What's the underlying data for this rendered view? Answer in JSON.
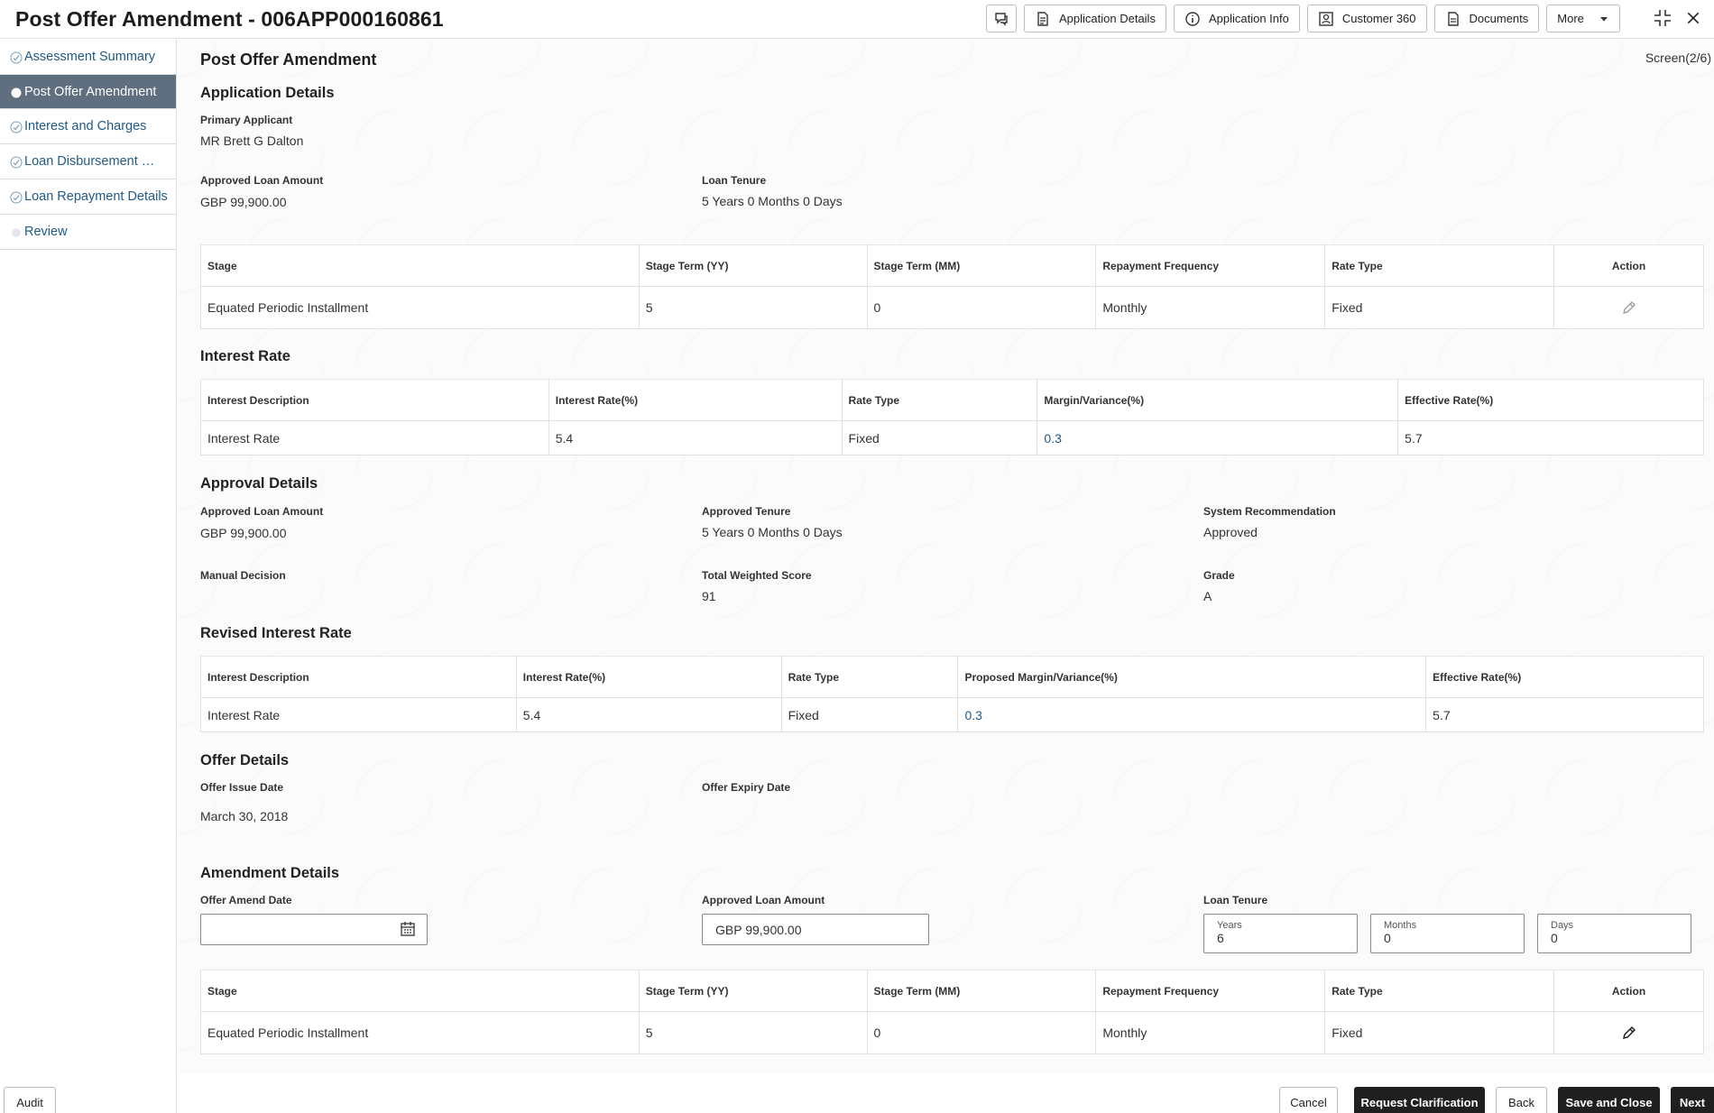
{
  "header": {
    "title": "Post Offer Amendment - 006APP000160861",
    "buttons": {
      "application_details": "Application Details",
      "application_info": "Application Info",
      "customer_360": "Customer 360",
      "documents": "Documents",
      "more": "More"
    }
  },
  "sidebar": {
    "items": [
      {
        "label": "Assessment Summary"
      },
      {
        "label": "Post Offer Amendment"
      },
      {
        "label": "Interest and Charges"
      },
      {
        "label": "Loan Disbursement Det..."
      },
      {
        "label": "Loan Repayment Details"
      },
      {
        "label": "Review"
      }
    ]
  },
  "main": {
    "title": "Post Offer Amendment",
    "screen": "Screen(2/6)",
    "application_details": {
      "heading": "Application Details",
      "primary_applicant_label": "Primary Applicant",
      "primary_applicant": "MR Brett G Dalton",
      "approved_amount_label": "Approved Loan Amount",
      "approved_amount": "GBP 99,900.00",
      "loan_tenure_label": "Loan Tenure",
      "loan_tenure": "5 Years 0 Months 0 Days",
      "stage_table": {
        "headers": [
          "Stage",
          "Stage Term (YY)",
          "Stage Term (MM)",
          "Repayment Frequency",
          "Rate Type",
          "Action"
        ],
        "row": [
          "Equated Periodic Installment",
          "5",
          "0",
          "Monthly",
          "Fixed"
        ]
      }
    },
    "interest_rate": {
      "heading": "Interest Rate",
      "headers": [
        "Interest Description",
        "Interest Rate(%)",
        "Rate Type",
        "Margin/Variance(%)",
        "Effective Rate(%)"
      ],
      "row": [
        "Interest Rate",
        "5.4",
        "Fixed",
        "0.3",
        "5.7"
      ]
    },
    "approval_details": {
      "heading": "Approval Details",
      "approved_amount_label": "Approved Loan Amount",
      "approved_amount": "GBP 99,900.00",
      "approved_tenure_label": "Approved Tenure",
      "approved_tenure": "5 Years 0 Months 0 Days",
      "system_rec_label": "System Recommendation",
      "system_rec": "Approved",
      "manual_decision_label": "Manual Decision",
      "total_score_label": "Total Weighted Score",
      "total_score": "91",
      "grade_label": "Grade",
      "grade": "A"
    },
    "revised_interest_rate": {
      "heading": "Revised Interest Rate",
      "headers": [
        "Interest Description",
        "Interest Rate(%)",
        "Rate Type",
        "Proposed Margin/Variance(%)",
        "Effective Rate(%)"
      ],
      "row": [
        "Interest Rate",
        "5.4",
        "Fixed",
        "0.3",
        "5.7"
      ]
    },
    "offer_details": {
      "heading": "Offer Details",
      "issue_date_label": "Offer Issue Date",
      "issue_date": "March 30, 2018",
      "expiry_date_label": "Offer Expiry Date"
    },
    "amendment_details": {
      "heading": "Amendment Details",
      "amend_date_label": "Offer Amend Date",
      "approved_amount_label": "Approved Loan Amount",
      "approved_amount": "GBP 99,900.00",
      "loan_tenure_label": "Loan Tenure",
      "years_label": "Years",
      "years": "6",
      "months_label": "Months",
      "months": "0",
      "days_label": "Days",
      "days": "0",
      "stage_table": {
        "headers": [
          "Stage",
          "Stage Term (YY)",
          "Stage Term (MM)",
          "Repayment Frequency",
          "Rate Type",
          "Action"
        ],
        "row": [
          "Equated Periodic Installment",
          "5",
          "0",
          "Monthly",
          "Fixed"
        ]
      }
    }
  },
  "footer": {
    "audit": "Audit",
    "cancel": "Cancel",
    "request_clarification": "Request Clarification",
    "back": "Back",
    "save_close": "Save and Close",
    "next": "Next"
  }
}
